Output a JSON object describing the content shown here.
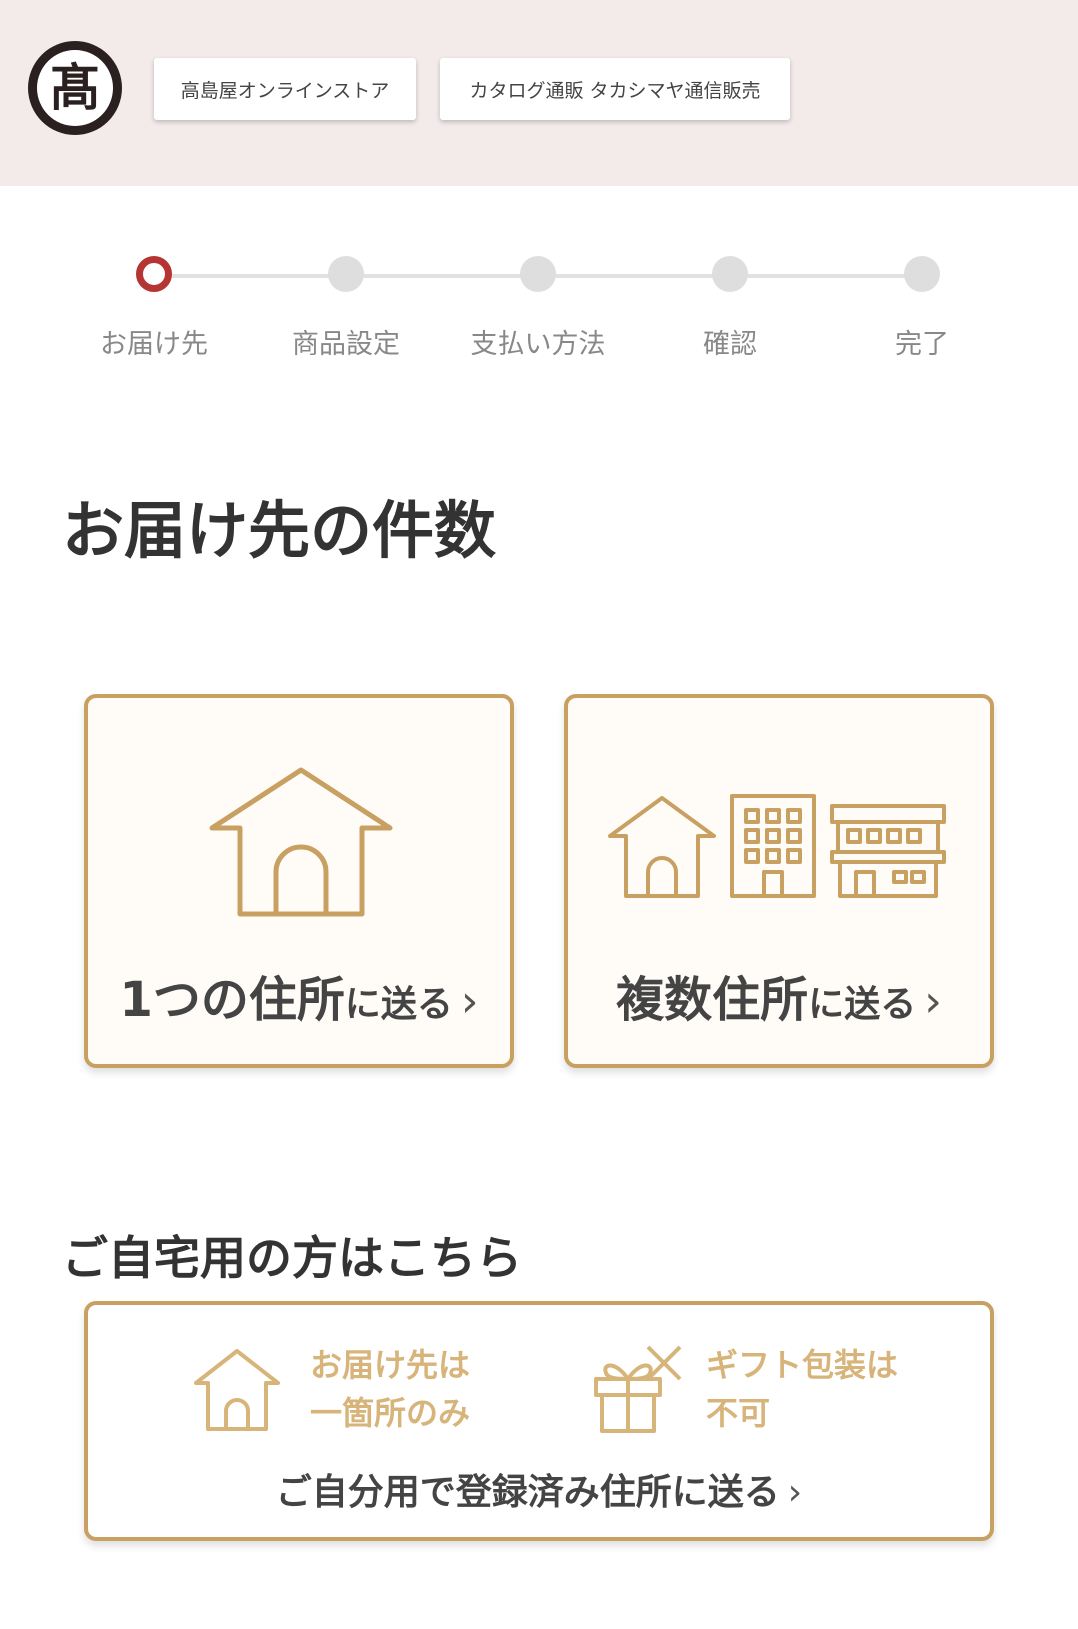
{
  "header": {
    "logo_text": "髙",
    "store_buttons": [
      {
        "label": "高島屋オンラインストア"
      },
      {
        "label": "カタログ通販 タカシマヤ通信販売"
      }
    ]
  },
  "stepper": {
    "steps": [
      {
        "label": "お届け先"
      },
      {
        "label": "商品設定"
      },
      {
        "label": "支払い方法"
      },
      {
        "label": "確認"
      },
      {
        "label": "完了"
      }
    ],
    "current_step": 1
  },
  "main": {
    "title": "お届け先の件数",
    "options": [
      {
        "label_main": "1つの住所",
        "label_suffix": "に送る",
        "chevron": "›"
      },
      {
        "label_main": "複数住所",
        "label_suffix": "に送る",
        "chevron": "›"
      }
    ]
  },
  "self_section": {
    "title": "ご自宅用の方はこちら",
    "feature_1_line1": "お届け先は",
    "feature_1_line2": "一箇所のみ",
    "feature_2_line1": "ギフト包装は",
    "feature_2_line2": "不可",
    "action_label": "ご自分用で登録済み住所に送る",
    "chevron": "›"
  },
  "colors": {
    "accent_gold": "#c8a062",
    "active_step": "#b53535",
    "header_bg": "#f3eaea"
  }
}
